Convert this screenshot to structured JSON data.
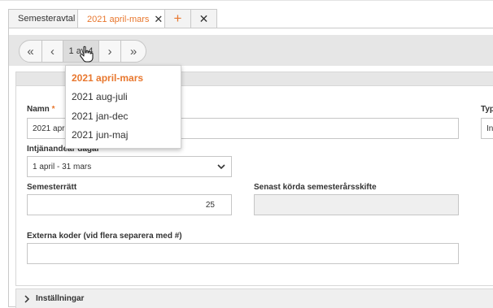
{
  "tabs": [
    {
      "label": "Semesteravtal"
    },
    {
      "label": "2021 april-mars"
    }
  ],
  "tab_icons": {
    "close": "close-icon",
    "add": "plus-icon",
    "close_all": "close-icon"
  },
  "pager": {
    "current": "1 av 4"
  },
  "form": {
    "namn": {
      "label": "Namn",
      "required": "*",
      "value": "2021 april"
    },
    "typ": {
      "label": "Typ",
      "value": "Int"
    },
    "intjanandear": {
      "label": "Intjänandeår dagar",
      "value": "1 april - 31 mars"
    },
    "semesterratt": {
      "label": "Semesterrätt",
      "value": "25"
    },
    "senast": {
      "label": "Senast körda semesterårsskifte",
      "value": ""
    },
    "externa": {
      "label": "Externa koder (vid flera separera med #)",
      "value": ""
    }
  },
  "collapse": {
    "label": "Inställningar"
  },
  "dropdown": {
    "options": [
      "2021 april-mars",
      "2021 aug-juli",
      "2021 jan-dec",
      "2021 jun-maj"
    ],
    "selected": "2021 april-mars"
  },
  "colors": {
    "accent": "#e8772e",
    "bar": "#e6e6e6",
    "border": "#c9c9c9"
  }
}
